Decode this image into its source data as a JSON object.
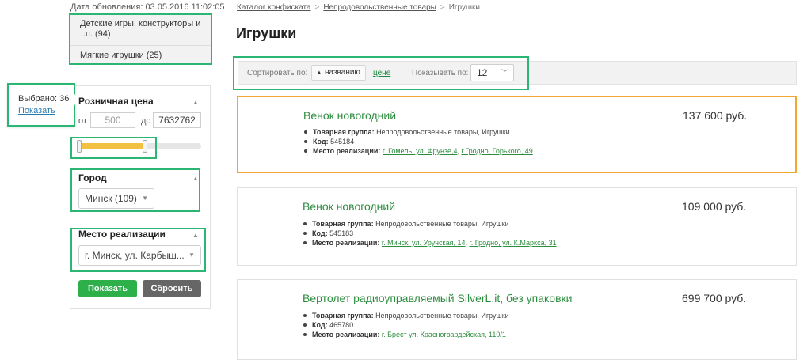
{
  "sidebar": {
    "update_date": "Дата обновления: 03.05.2016 11:02:05",
    "categories": [
      {
        "label": "Детские игры, конструкторы и т.п. (94)"
      },
      {
        "label": "Мягкие игрушки (25)"
      }
    ],
    "selected_popup": {
      "text": "Выбрано: 36",
      "link": "Показать"
    },
    "price_filter": {
      "title": "Розничная цена",
      "from_label": "от",
      "to_label": "до",
      "from_value": "500",
      "to_value": "7632762",
      "slider_low": 0.0,
      "slider_high": 0.54
    },
    "city_filter": {
      "title": "Город",
      "selected": "Минск (109)"
    },
    "place_filter": {
      "title": "Место реализации",
      "selected": "г. Минск, ул. Карбыш..."
    },
    "buttons": {
      "show": "Показать",
      "reset": "Сбросить"
    }
  },
  "breadcrumb": {
    "items": [
      "Каталог конфиската",
      "Непродовольственные товары",
      "Игрушки"
    ],
    "separator": ">"
  },
  "page_title": "Игрушки",
  "sort_bar": {
    "sort_label": "Сортировать по:",
    "sort_by_name": "названию",
    "sort_by_price": "цене",
    "per_page_label": "Показывать по:",
    "per_page_value": "12"
  },
  "products": [
    {
      "title": "Венок новогодний",
      "price": "137 600 руб.",
      "group_label": "Товарная группа",
      "group_value": "Непродовольственные товары, Игрушки",
      "code_label": "Код",
      "code_value": "545184",
      "place_label": "Место реализации",
      "place_links": [
        "г. Гомель, ул. Фрунзе,4",
        "г.Гродно, Горького, 49"
      ]
    },
    {
      "title": "Венок новогодний",
      "price": "109 000 руб.",
      "group_label": "Товарная группа",
      "group_value": "Непродовольственные товары, Игрушки",
      "code_label": "Код",
      "code_value": "545183",
      "place_label": "Место реализации",
      "place_links": [
        "г. Минск, ул. Уручская, 14",
        "г. Гродно, ул. К.Маркса, 31"
      ]
    },
    {
      "title": "Вертолет радиоуправляемый SilverL.it, без упаковки",
      "price": "699 700 руб.",
      "group_label": "Товарная группа",
      "group_value": "Непродовольственные товары, Игрушки",
      "code_label": "Код",
      "code_value": "465780",
      "place_label": "Место реализации",
      "place_links": [
        "г. Брест ул. Красногвардейская, 110/1"
      ]
    }
  ]
}
